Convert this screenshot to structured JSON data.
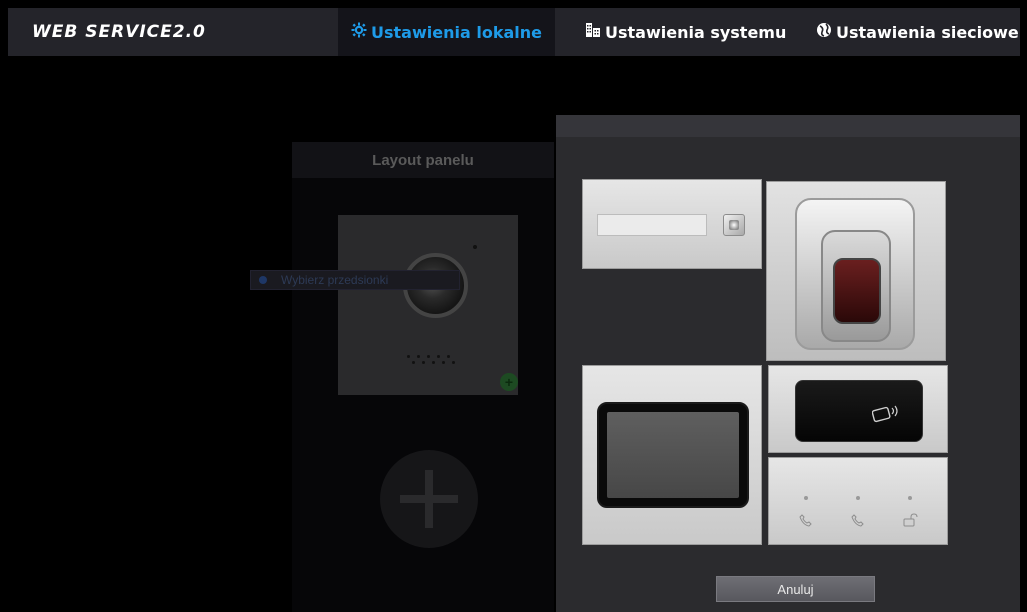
{
  "app": {
    "logo": "WEB SERVICE2.0"
  },
  "nav": {
    "local": {
      "label": "Ustawienia lokalne",
      "icon": "gear-icon",
      "active": true
    },
    "system": {
      "label": "Ustawienia systemu",
      "icon": "building-icon"
    },
    "network": {
      "label": "Ustawienia sieciowe",
      "icon": "globe-icon"
    }
  },
  "layout_panel": {
    "title": "Layout panelu",
    "tooltip": "Wybierz przedsionki"
  },
  "picker": {
    "modules": [
      {
        "name": "button-module"
      },
      {
        "name": "fingerprint-module"
      },
      {
        "name": "display-module"
      },
      {
        "name": "card-reader-module"
      },
      {
        "name": "call-buttons-module"
      }
    ],
    "cancel_label": "Anuluj"
  },
  "colors": {
    "accent": "#1e9be8",
    "topbar": "#24242a",
    "dialog": "#2b2b2e"
  }
}
